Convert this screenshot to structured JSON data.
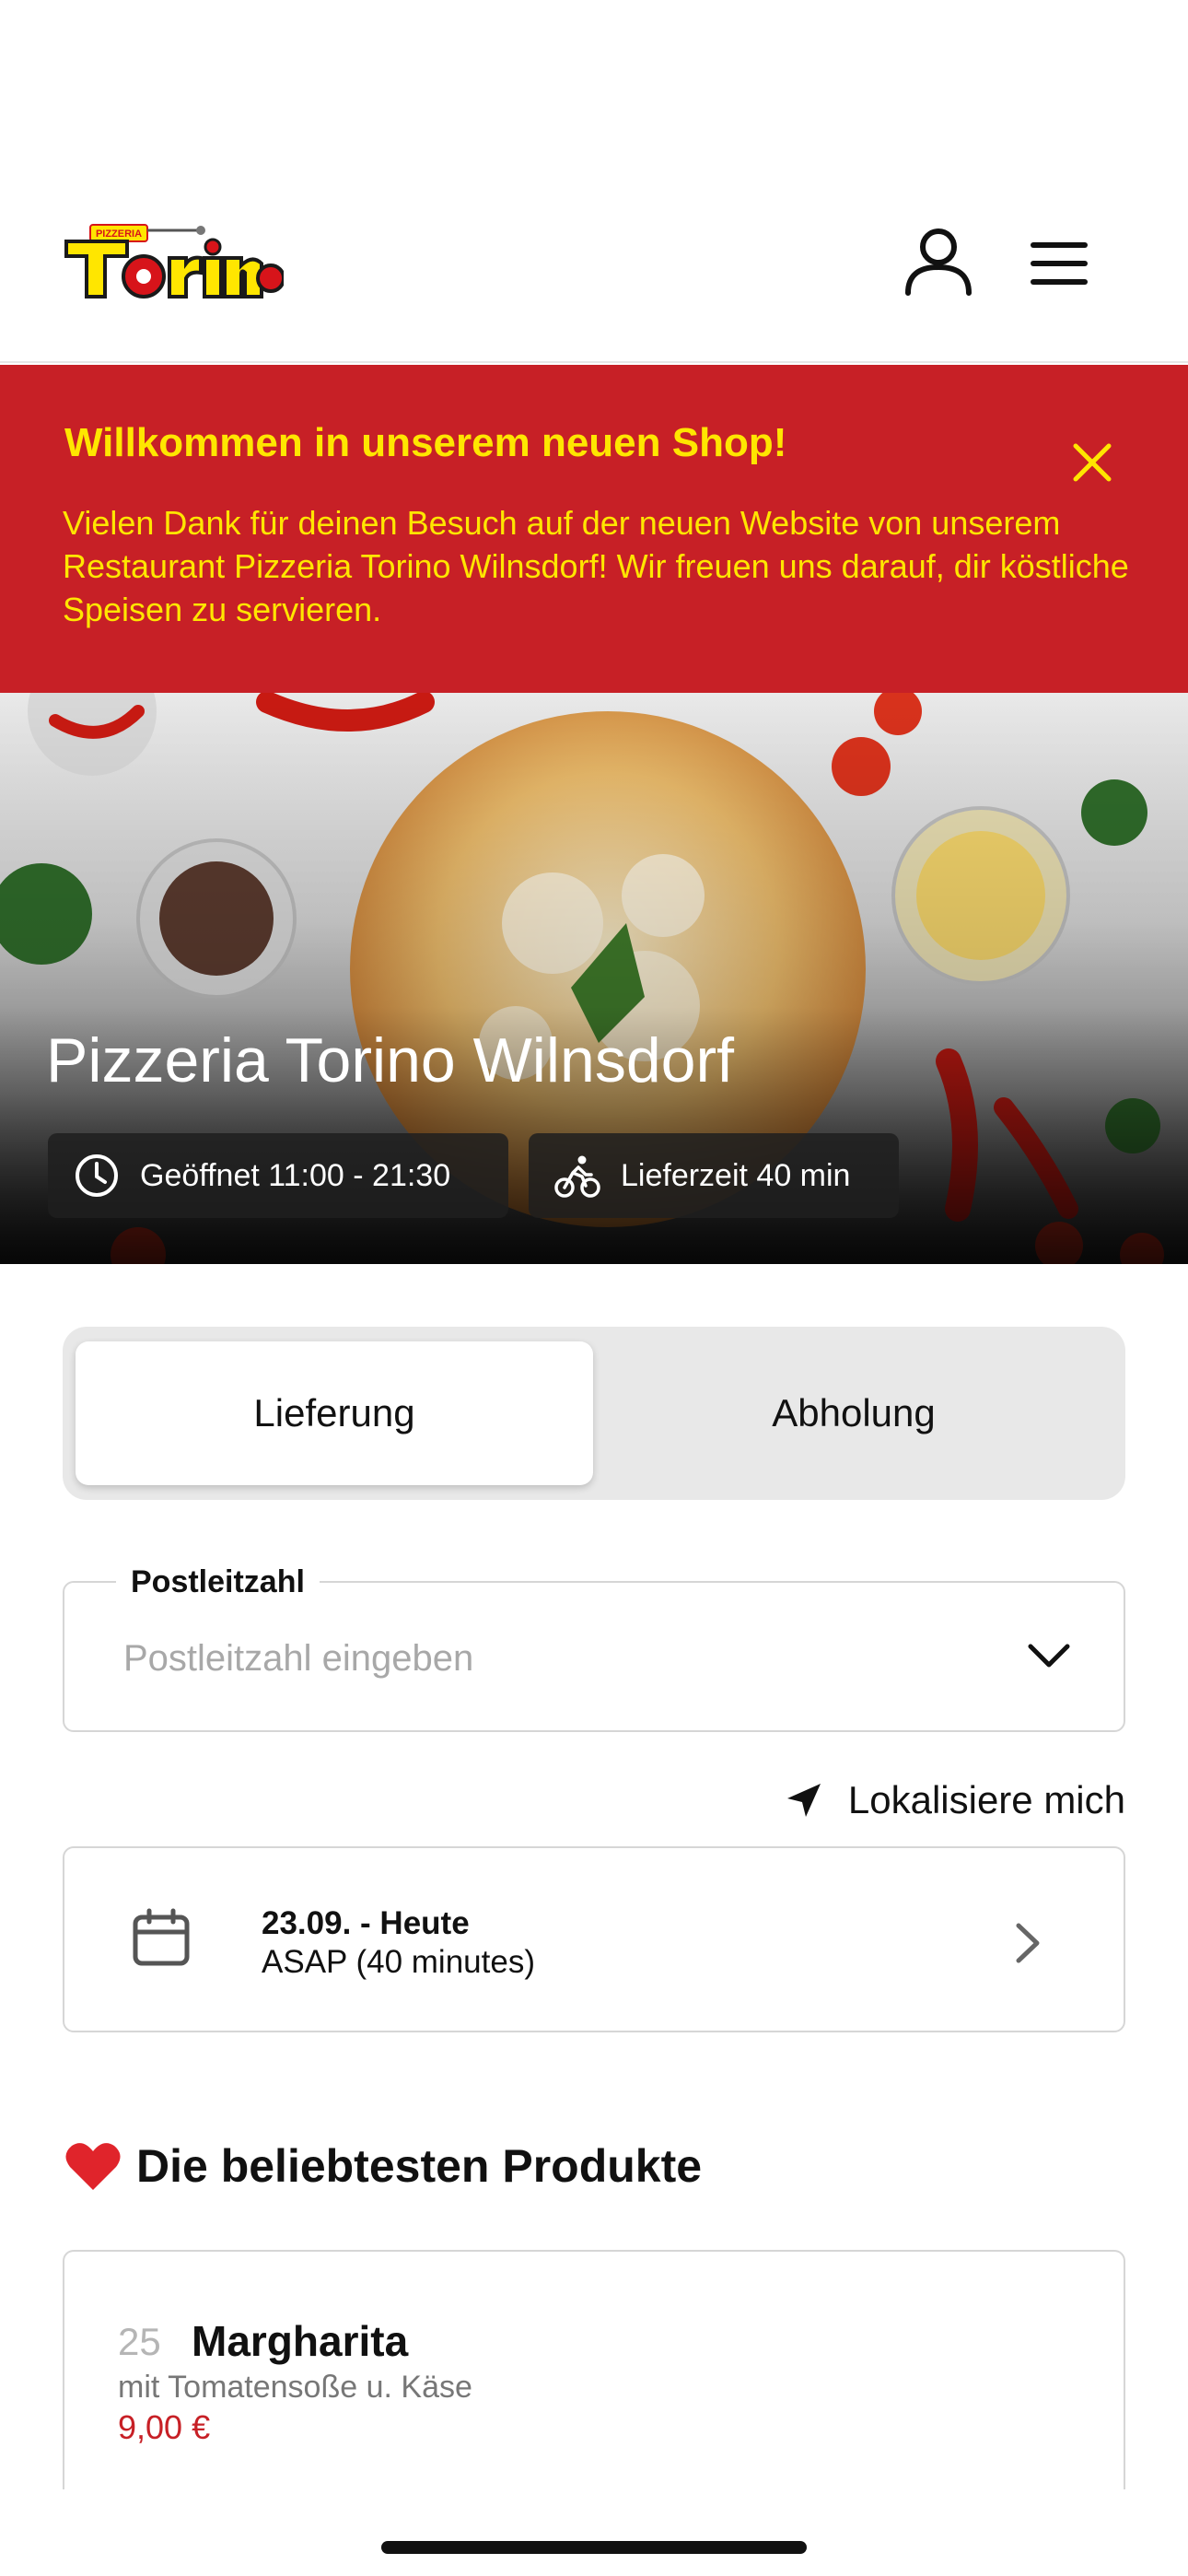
{
  "header": {
    "logo_text_top": "PIZZERIA",
    "logo_text_main": "Torino",
    "logo_colors": {
      "yellow": "#ffe600",
      "red": "#d7141a"
    }
  },
  "banner": {
    "title": "Willkommen in unserem neuen Shop!",
    "text": "Vielen Dank für deinen Besuch auf der neuen Website von unserem Restaurant Pizzeria Torino Wilnsdorf! Wir freuen uns darauf, dir köstliche Speisen zu servieren.",
    "background": "#c72026",
    "text_color": "#ffe600"
  },
  "hero": {
    "title": "Pizzeria Torino Wilnsdorf",
    "opening_hours": "Geöffnet 11:00 - 21:30",
    "delivery_time": "Lieferzeit 40 min"
  },
  "order_mode": {
    "delivery_label": "Lieferung",
    "pickup_label": "Abholung",
    "selected": "Lieferung"
  },
  "postal": {
    "label": "Postleitzahl",
    "placeholder": "Postleitzahl eingeben"
  },
  "localize": {
    "label": "Lokalisiere mich"
  },
  "time": {
    "date": "23.09. - Heute",
    "subtitle": "ASAP (40 minutes)"
  },
  "popular": {
    "title": "Die beliebtesten Produkte",
    "products": [
      {
        "number": "25",
        "name": "Margharita",
        "description": "mit Tomatensoße u. Käse",
        "price": "9,00 €"
      }
    ]
  }
}
